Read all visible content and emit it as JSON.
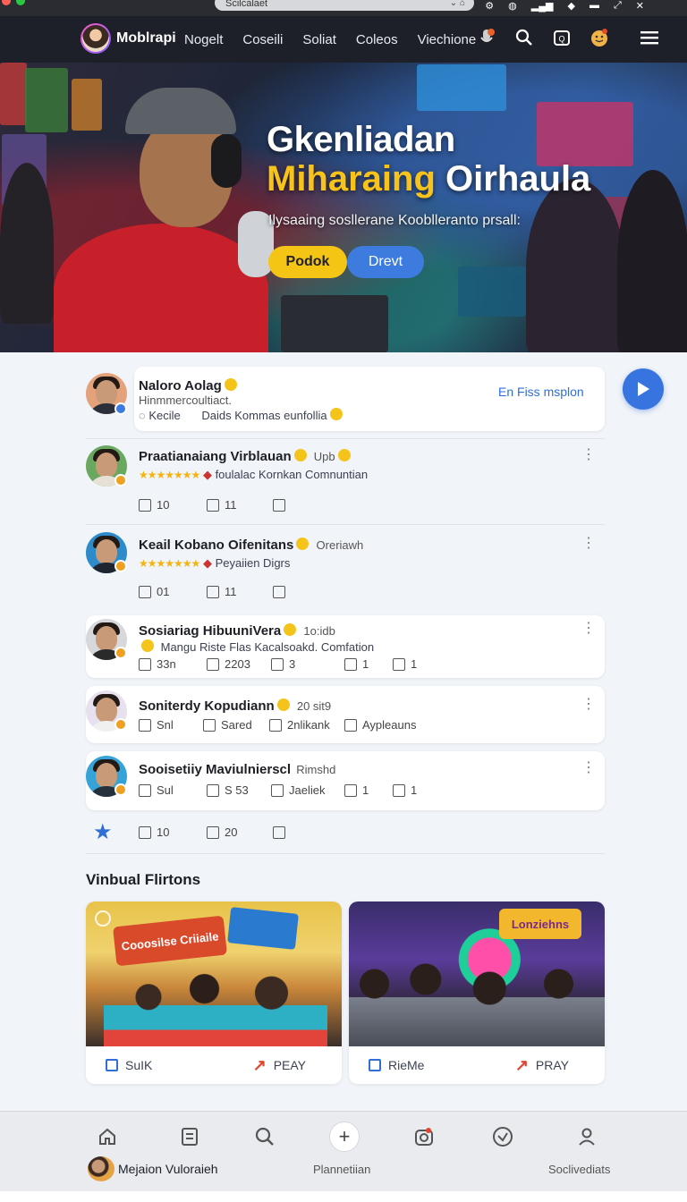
{
  "browser": {
    "url": "Scilcalaet",
    "window_dots": [
      "#ff5f57",
      "#febc2e",
      "#28c840"
    ]
  },
  "topnav": {
    "brand": "Moblrapi",
    "links": [
      "Nogelt",
      "Coseili",
      "Soliat",
      "Coleos",
      "Viechione"
    ]
  },
  "hero": {
    "title_line1": "Gkenliadan",
    "title_line2_accent": "Miharaing",
    "title_line2_rest": "Oirhaula",
    "subtitle": "Ilysaaing soslleranе Koobllеranto prsall:",
    "primary_button": "Podok",
    "secondary_button": "Drevt"
  },
  "feed": {
    "pinned": {
      "name": "Naloro Aolag",
      "handle": "Hinmmercoultiact.",
      "reply_label": "Kecile",
      "caption": "Daids Kommas eunfollia",
      "follow_link": "En Fiss msplon"
    },
    "posts": [
      {
        "name": "Praatianaiang Virblauan",
        "tag": "Upb",
        "stars": "★★★★★★★",
        "subtitle": "foulalac Kornkan Comnuntian",
        "actions": [
          "10",
          "11",
          ""
        ]
      },
      {
        "name": "Keail Kobano Oifenitans",
        "tag": "Oreriawh",
        "stars": "★★★★★★★",
        "subtitle": "Peyaiien Digrs",
        "actions": [
          "01",
          "11",
          ""
        ]
      },
      {
        "name": "Sosiariag HibuuniVera",
        "tag": "1o:idb",
        "subtitle": "Mangu Riste Flas Kacalsoakd. Comfation",
        "actions": [
          "33n",
          "2203",
          "3",
          "1",
          "1"
        ]
      },
      {
        "name": "Soniterdy Kopudiann",
        "tag": "20 sit9",
        "actions": [
          "Snl",
          "Sared",
          "2nlikank",
          "Ayplеauns"
        ]
      },
      {
        "name": "Sooisetiiy Maviulnierscl",
        "tag": "Rimshd",
        "actions": [
          "Sul",
          "S  53",
          "Jaeliek",
          "1",
          "1"
        ]
      }
    ],
    "summary_actions": [
      "10",
      "20",
      ""
    ]
  },
  "virtual": {
    "title": "Vinbual Flirtons",
    "cards": [
      {
        "image_label": "Cooosilse Criiaile",
        "left_label": "SuIK",
        "right_label": "PEAY"
      },
      {
        "image_label": "Lonziehns",
        "left_label": "RieMe",
        "right_label": "PRAY"
      }
    ]
  },
  "tabbar": {
    "home_label": "Mejaion Vuloraieh",
    "center_label": "Plannetiian",
    "right_label": "Soclivediats"
  }
}
